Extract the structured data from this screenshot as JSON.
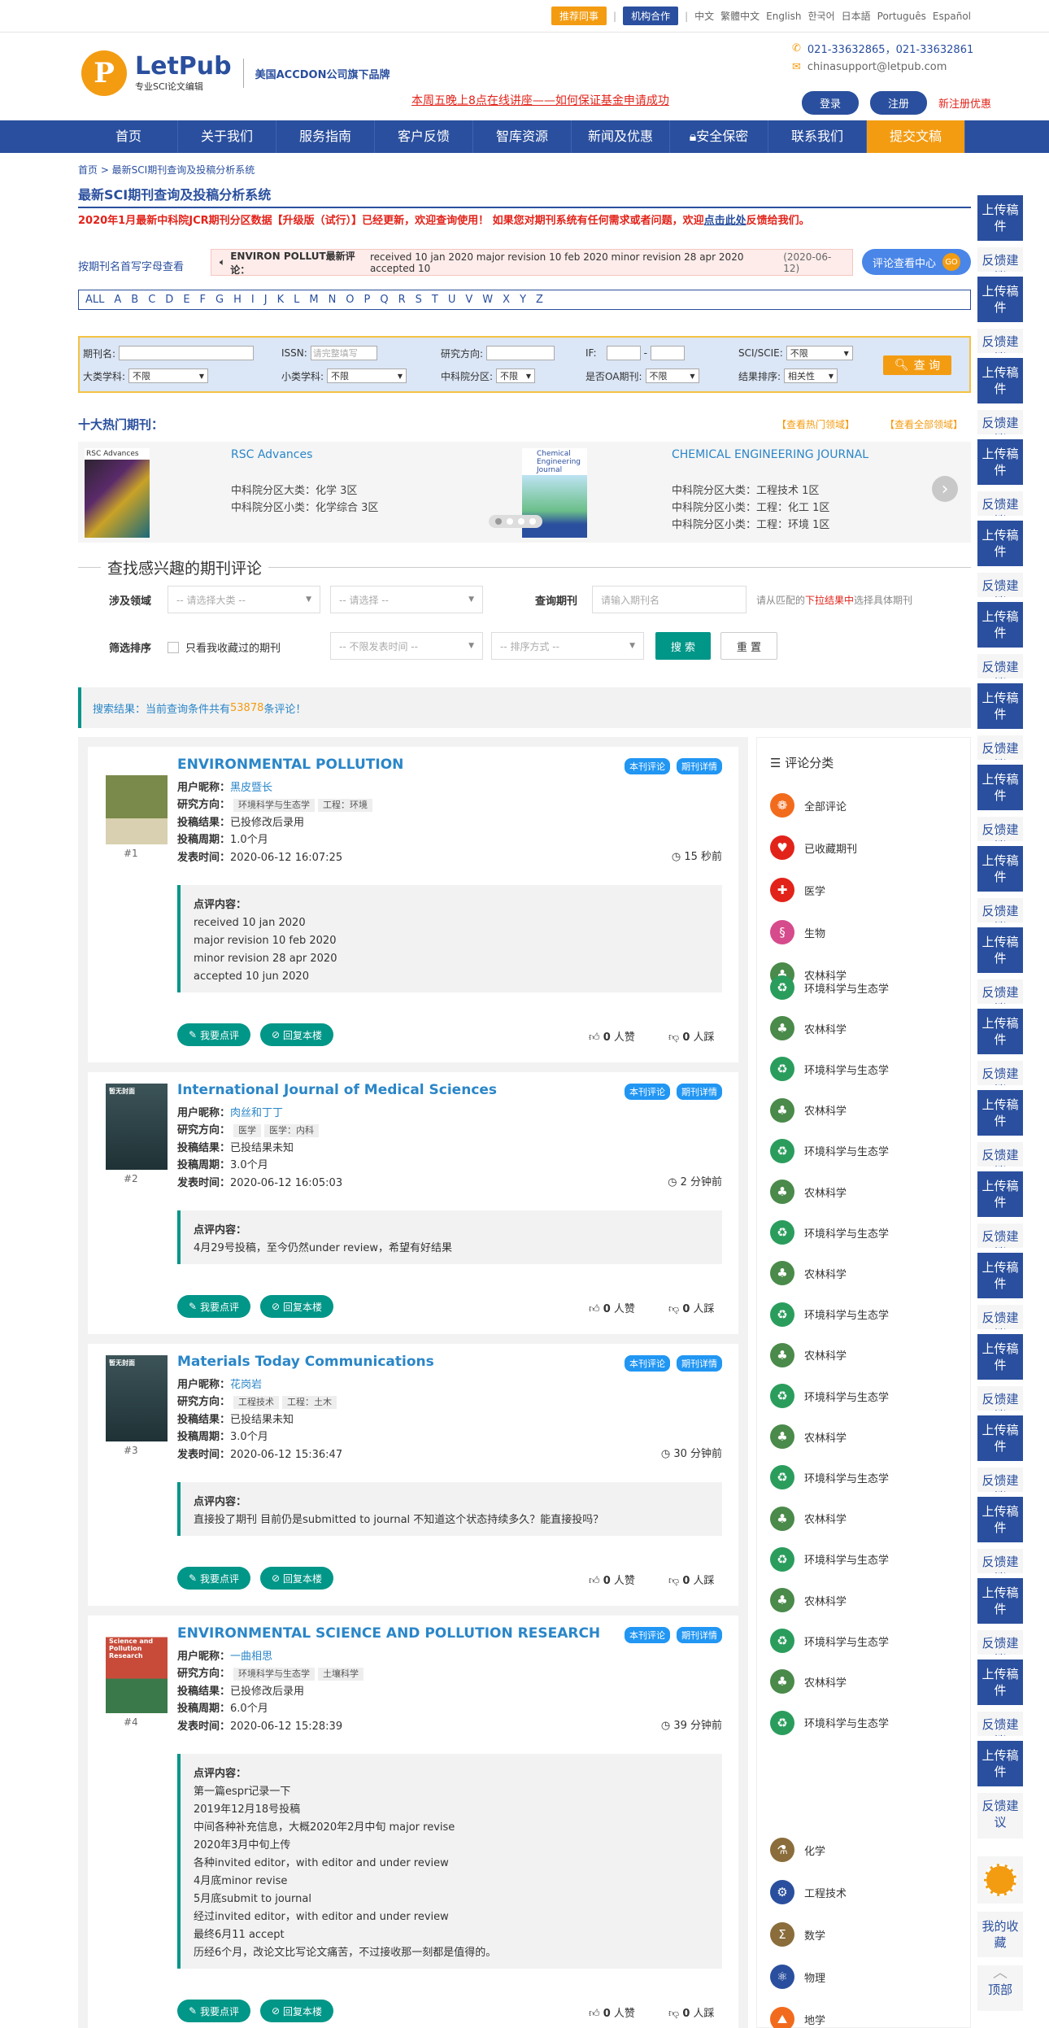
{
  "topbar": {
    "btn1": "推荐同事",
    "btn2": "机构合作",
    "langs": [
      "中文",
      "繁體中文",
      "English",
      "한국어",
      "日本語",
      "Português",
      "Español"
    ]
  },
  "header": {
    "logo_letter": "P",
    "logo_title": "LetPub",
    "logo_sub": "专业SCI论文编辑",
    "tagline": "美国ACCDON公司旗下品牌",
    "promo": "本周五晚上8点在线讲座——如何保证基金申请成功",
    "phone": "021-33632865，021-33632861",
    "email": "chinasupport@letpub.com",
    "login": "登录",
    "register": "注册",
    "register_promo": "新注册优惠"
  },
  "nav": [
    "首页",
    "关于我们",
    "服务指南",
    "客户反馈",
    "智库资源",
    "新闻及优惠",
    "安全保密",
    "联系我们",
    "提交文稿"
  ],
  "page": {
    "breadcrumb": "首页 > 最新SCI期刊查询及投稿分析系统",
    "title": "最新SCI期刊查询及投稿分析系统",
    "notice_1": "2020年1月最新中科院JCR期刊分区数据【升级版（试行）】已经更新，欢迎查询使用！ 如果您对期刊系统有任何需求或者问题，欢迎",
    "notice_link": "点击此处",
    "notice_2": "反馈给我们。"
  },
  "quick": {
    "label": "按期刊名首写字母查看",
    "scroll_title": "ENVIRON POLLUT最新评论：",
    "scroll_text": "received 10 jan 2020 major revision 10 feb 2020 minor revision 28 apr 2020 accepted 10",
    "scroll_date": "(2020-06-12)",
    "review_center": "评论查看中心",
    "go": "GO"
  },
  "alphabet": [
    "ALL",
    "A",
    "B",
    "C",
    "D",
    "E",
    "F",
    "G",
    "H",
    "I",
    "J",
    "K",
    "L",
    "M",
    "N",
    "O",
    "P",
    "Q",
    "R",
    "S",
    "T",
    "U",
    "V",
    "W",
    "X",
    "Y",
    "Z"
  ],
  "search": {
    "journal_name": "期刊名:",
    "issn": "ISSN:",
    "issn_ph": "请完整填写",
    "direction": "研究方向:",
    "if": "IF:",
    "scie": "SCI/SCIE:",
    "scie_val": "不限",
    "big": "大类学科:",
    "big_val": "不限",
    "small": "小类学科:",
    "small_val": "不限",
    "cas": "中科院分区:",
    "cas_val": "不限",
    "oa": "是否OA期刊:",
    "oa_val": "不限",
    "sort": "结果排序:",
    "sort_val": "相关性",
    "btn": "查 询"
  },
  "hot": {
    "title": "十大热门期刊：",
    "link1": "【查看热门领域】",
    "link2": "【查看全部领域】",
    "j1_cover": "RSC Advances",
    "j1_name": "RSC Advances",
    "j1_l1": "中科院分区大类：化学 3区",
    "j1_l2": "中科院分区小类：化学综合 3区",
    "j2_cover": "Chemical Engineering Journal",
    "j2_name": "CHEMICAL ENGINEERING JOURNAL",
    "j2_l1": "中科院分区大类：工程技术 1区",
    "j2_l2": "中科院分区小类：工程：化工 1区",
    "j2_l3": "中科院分区小类：工程：环境 1区",
    "next": "›"
  },
  "filter": {
    "title": "查找感兴趣的期刊评论",
    "field_label": "涉及领域",
    "sel1": "-- 请选择大类 --",
    "sel2": "-- 请选择 --",
    "query_label": "查询期刊",
    "query_ph": "请输入期刊名",
    "hint_1": "请从匹配的",
    "hint_red": "下拉结果中",
    "hint_2": "选择具体期刊",
    "sort_label": "筛选排序",
    "fav": "只看我收藏过的期刊",
    "time": "-- 不限发表时间 --",
    "order": "-- 排序方式 --",
    "search_btn": "搜 索",
    "reset_btn": "重 置"
  },
  "result": {
    "prefix": "搜索结果：当前查询条件共有",
    "count": "53878",
    "suffix": "条评论！"
  },
  "labels": {
    "user": "用户昵称：",
    "dir": "研究方向：",
    "status": "投稿结果：",
    "period": "投稿周期：",
    "time": "发表时间：",
    "content": "点评内容：",
    "tag1": "本刊评论",
    "tag2": "期刊详情",
    "reply": "我要点评",
    "reply2": "回复本楼",
    "likes": "人赞",
    "dislikes": "人踩",
    "zero": "0"
  },
  "reviews": [
    {
      "rank": "#1",
      "cover": "ENVIRONMENTAL POLLUTION",
      "journal": "ENVIRONMENTAL POLLUTION",
      "user": "黑皮暨长",
      "dirs": [
        "环境科学与生态学",
        "工程：环境"
      ],
      "status": "已投修改后录用",
      "period": "1.0个月",
      "time": "2020-06-12 16:07:25",
      "ago": "15 秒前",
      "lines": [
        "received 10 jan 2020",
        "major revision 10 feb 2020",
        "minor revision 28 apr 2020",
        "accepted 10 jun 2020"
      ]
    },
    {
      "rank": "#2",
      "cover": "暂无封面",
      "journal": "International Journal of Medical Sciences",
      "user": "肉丝和丁丁",
      "dirs": [
        "医学",
        "医学：内科"
      ],
      "status": "已投结果未知",
      "period": "3.0个月",
      "time": "2020-06-12 16:05:03",
      "ago": "2 分钟前",
      "lines": [
        "4月29号投稿，至今仍然under review，希望有好结果"
      ]
    },
    {
      "rank": "#3",
      "cover": "暂无封面",
      "journal": "Materials Today Communications",
      "user": "花岗岩",
      "dirs": [
        "工程技术",
        "工程：土木"
      ],
      "status": "已投结果未知",
      "period": "3.0个月",
      "time": "2020-06-12 15:36:47",
      "ago": "30 分钟前",
      "lines": [
        "直接投了期刊 目前仍是submitted to journal 不知道这个状态持续多久？能直接投吗？"
      ]
    },
    {
      "rank": "#4",
      "cover": "Environmental Science and Pollution Research",
      "journal": "ENVIRONMENTAL SCIENCE AND POLLUTION RESEARCH",
      "user": "一曲相思",
      "dirs": [
        "环境科学与生态学",
        "土壤科学"
      ],
      "status": "已投修改后录用",
      "period": "6.0个月",
      "time": "2020-06-12 15:28:39",
      "ago": "39 分钟前",
      "lines": [
        "第一篇espr记录一下",
        "2019年12月18号投稿",
        "中间各种补充信息，大概2020年2月中旬 major revise",
        "2020年3月中旬上传",
        "各种invited editor，with editor and under review",
        "4月底minor revise",
        "5月底submit to journal",
        "经过invited editor，with editor and under review",
        "最终6月11 accept",
        "历经6个月，改论文比写论文痛苦，不过接收那一刻都是值得的。"
      ]
    }
  ],
  "categories": {
    "title": "评论分类",
    "items": [
      "全部评论",
      "已收藏期刊",
      "医学",
      "生物",
      "农林科学",
      "环境科学与生态学",
      "农林科学",
      "环境科学与生态学",
      "农林科学",
      "环境科学与生态学",
      "农林科学",
      "环境科学与生态学",
      "农林科学",
      "环境科学与生态学",
      "农林科学",
      "环境科学与生态学",
      "农林科学",
      "环境科学与生态学",
      "农林科学",
      "环境科学与生态学",
      "农林科学",
      "环境科学与生态学",
      "农林科学",
      "环境科学与生态学",
      "化学",
      "工程技术",
      "数学",
      "物理",
      "地学"
    ],
    "colors": {
      "orange": "#f26b1d",
      "red": "#e2231a",
      "green": "#4a8a4a",
      "teal": "#2a9d5c",
      "pink": "#d64b8c",
      "brown": "#8a6d3b",
      "blue": "#2a4f9e"
    }
  },
  "sidebar": {
    "upload": "上传稿件",
    "feedback": "反馈建议",
    "collect": "我的收藏",
    "top": "顶部",
    "top_icon": "︿"
  }
}
